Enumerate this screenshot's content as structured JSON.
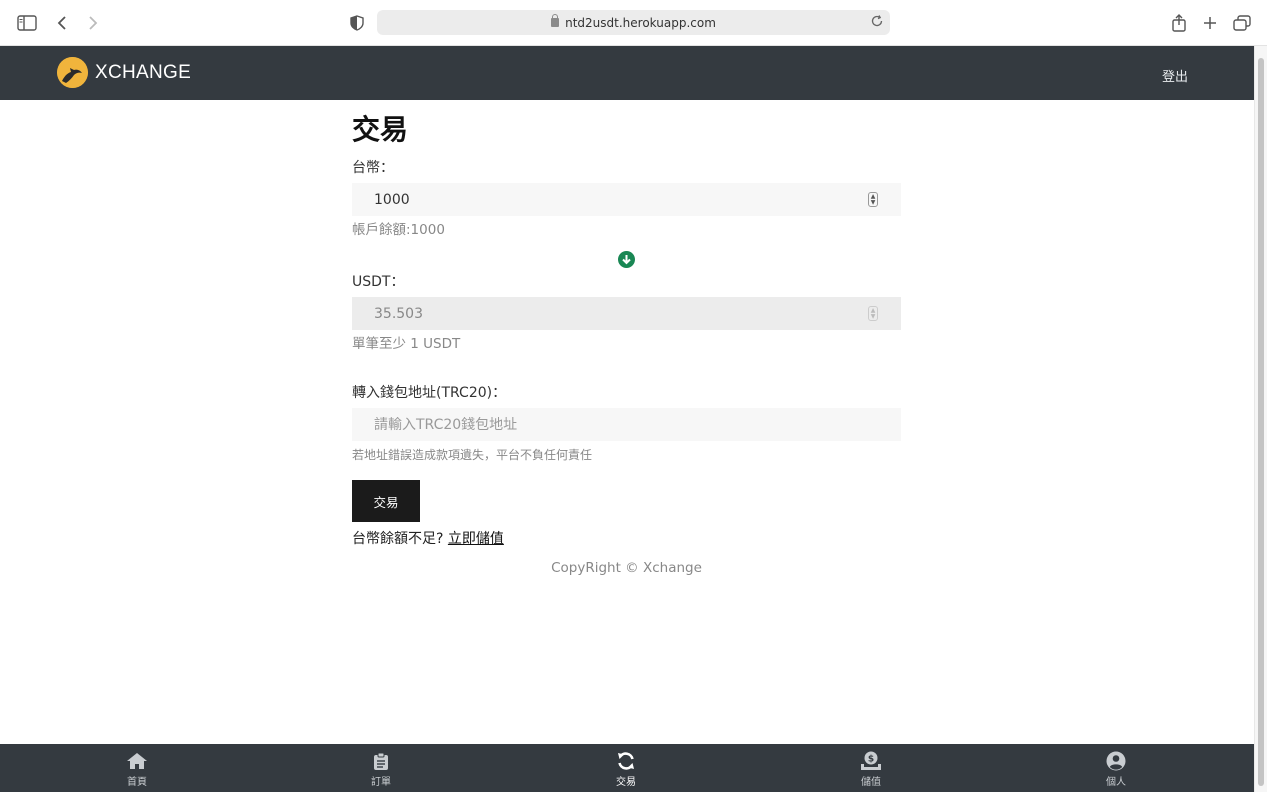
{
  "browser": {
    "url": "ntd2usdt.herokuapp.com"
  },
  "header": {
    "brand": "XCHANGE",
    "logout_label": "登出"
  },
  "page": {
    "title": "交易"
  },
  "form": {
    "twd_label": "台幣：",
    "twd_value": "1000",
    "balance_text": "帳戶餘額:1000",
    "usdt_label": "USDT：",
    "usdt_value": "35.503",
    "usdt_help": "單筆至少 1 USDT",
    "wallet_label": "轉入錢包地址(TRC20)：",
    "wallet_placeholder": "請輸入TRC20錢包地址",
    "wallet_help": "若地址錯誤造成款項遺失，平台不負任何責任",
    "submit_label": "交易",
    "insufficient_text": "台幣餘額不足?",
    "topup_link": "立即儲值"
  },
  "footer": {
    "copyright": "CopyRight © Xchange"
  },
  "bottom_nav": {
    "items": [
      {
        "label": "首頁",
        "icon": "home-icon"
      },
      {
        "label": "訂單",
        "icon": "clipboard-icon"
      },
      {
        "label": "交易",
        "icon": "sync-icon",
        "active": true
      },
      {
        "label": "儲值",
        "icon": "deposit-icon"
      },
      {
        "label": "個人",
        "icon": "user-icon"
      }
    ]
  },
  "colors": {
    "navbar": "#343a40",
    "accent_green": "#198754",
    "logo": "#f0b43c",
    "button": "#1b1b1b"
  }
}
